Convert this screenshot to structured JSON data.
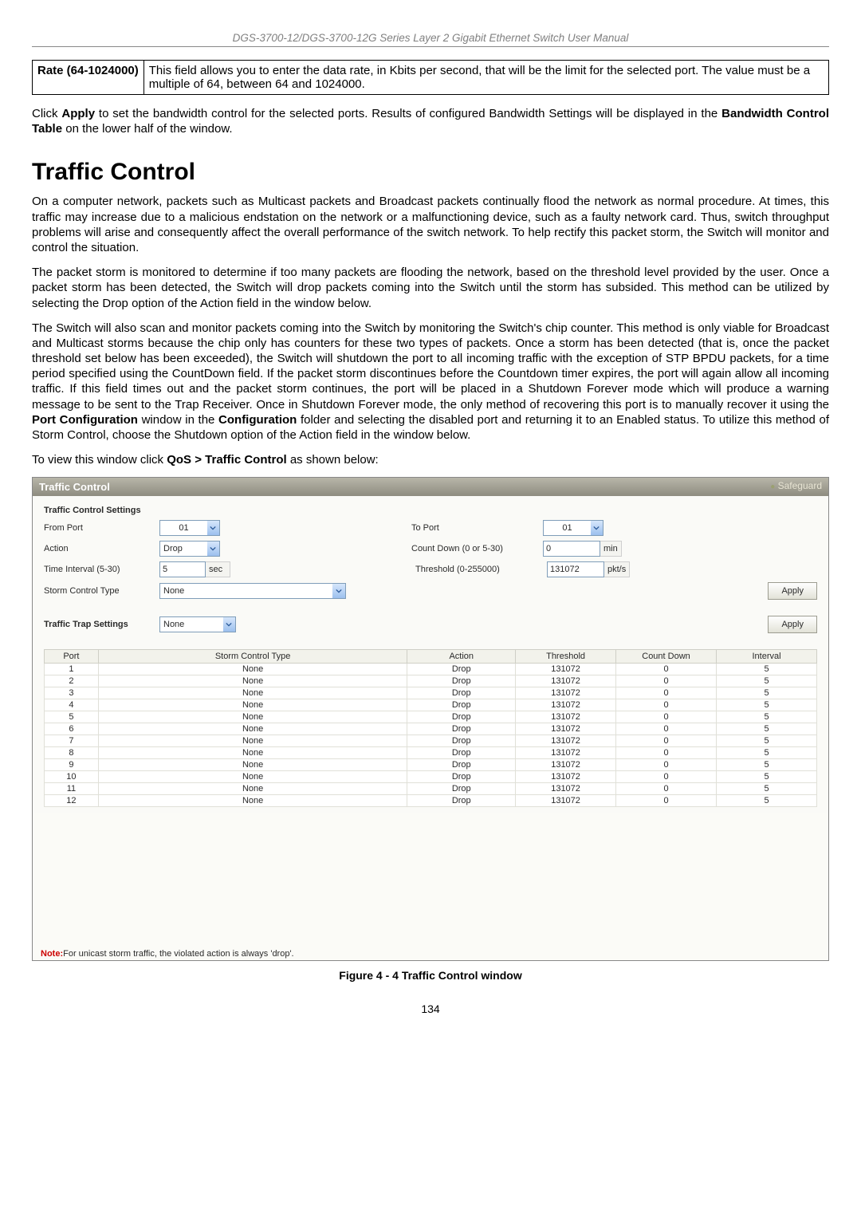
{
  "doc_header": "DGS-3700-12/DGS-3700-12G Series Layer 2 Gigabit Ethernet Switch User Manual",
  "rate_row": {
    "label": "Rate (64-1024000)",
    "desc": "This field allows you to enter the data rate, in Kbits per second, that will be the limit for the selected port. The value must be a multiple of 64, between 64 and 1024000."
  },
  "apply_para": {
    "pre": "Click ",
    "b1": "Apply",
    "mid": " to set the bandwidth control for the selected ports. Results of configured Bandwidth Settings will be displayed in the ",
    "b2": "Bandwidth Control Table",
    "post": " on the lower half of the window."
  },
  "section_title": "Traffic Control",
  "p1": "On a computer network, packets such as Multicast packets and Broadcast packets continually flood the network as normal procedure. At times, this traffic may increase due to a malicious endstation on the network or a malfunctioning device, such as a faulty network card. Thus, switch throughput problems will arise and consequently affect the overall performance of the switch network. To help rectify this packet storm, the Switch will monitor and control the situation.",
  "p2": "The packet storm is monitored to determine if too many packets are flooding the network, based on the threshold level provided by the user. Once a packet storm has been detected, the Switch will drop packets coming into the Switch until the storm has subsided. This method can be utilized by selecting the Drop option of the Action field in the window below.",
  "p3": {
    "a": "The Switch will also scan and monitor packets coming into the Switch by monitoring the Switch's chip counter. This method is only viable for Broadcast and Multicast storms because the chip only has counters for these two types of packets. Once a storm has been detected (that is, once the packet threshold set below has been exceeded), the Switch will shutdown the port to all incoming traffic with the exception of STP BPDU packets, for a time period specified using the CountDown field. If the packet storm discontinues before the Countdown timer expires, the port will again allow all incoming traffic. If this field times out and the packet storm continues, the port will be placed in a Shutdown Forever mode which will produce a warning message to be sent to the Trap Receiver. Once in Shutdown Forever mode, the only method of recovering this port is to manually recover it using the ",
    "b1": "Port Configuration",
    "b": " window in the ",
    "b2": "Configuration",
    "c": " folder and selecting the disabled port and returning it to an Enabled status. To utilize this method of Storm Control, choose the Shutdown option of the Action field in the window below."
  },
  "p4": {
    "pre": "To view this window click ",
    "b": "QoS > Traffic Control",
    "post": " as shown below:"
  },
  "win": {
    "title": "Traffic Control",
    "safeguard": "Safeguard",
    "settings_head": "Traffic Control Settings",
    "from_port_lab": "From Port",
    "from_port_val": "01",
    "to_port_lab": "To Port",
    "to_port_val": "01",
    "action_lab": "Action",
    "action_val": "Drop",
    "countdown_lab": "Count Down (0 or 5-30)",
    "countdown_val": "0",
    "countdown_unit": "min",
    "interval_lab": "Time Interval (5-30)",
    "interval_val": "5",
    "interval_unit": "sec",
    "threshold_lab": "Threshold (0-255000)",
    "threshold_val": "131072",
    "threshold_unit": "pkt/s",
    "storm_lab": "Storm Control Type",
    "storm_val": "None",
    "apply_btn": "Apply",
    "trap_head": "Traffic Trap Settings",
    "trap_val": "None",
    "cols": {
      "c0": "Port",
      "c1": "Storm Control Type",
      "c2": "Action",
      "c3": "Threshold",
      "c4": "Count Down",
      "c5": "Interval"
    },
    "rows": [
      {
        "port": "1",
        "type": "None",
        "action": "Drop",
        "th": "131072",
        "cd": "0",
        "iv": "5"
      },
      {
        "port": "2",
        "type": "None",
        "action": "Drop",
        "th": "131072",
        "cd": "0",
        "iv": "5"
      },
      {
        "port": "3",
        "type": "None",
        "action": "Drop",
        "th": "131072",
        "cd": "0",
        "iv": "5"
      },
      {
        "port": "4",
        "type": "None",
        "action": "Drop",
        "th": "131072",
        "cd": "0",
        "iv": "5"
      },
      {
        "port": "5",
        "type": "None",
        "action": "Drop",
        "th": "131072",
        "cd": "0",
        "iv": "5"
      },
      {
        "port": "6",
        "type": "None",
        "action": "Drop",
        "th": "131072",
        "cd": "0",
        "iv": "5"
      },
      {
        "port": "7",
        "type": "None",
        "action": "Drop",
        "th": "131072",
        "cd": "0",
        "iv": "5"
      },
      {
        "port": "8",
        "type": "None",
        "action": "Drop",
        "th": "131072",
        "cd": "0",
        "iv": "5"
      },
      {
        "port": "9",
        "type": "None",
        "action": "Drop",
        "th": "131072",
        "cd": "0",
        "iv": "5"
      },
      {
        "port": "10",
        "type": "None",
        "action": "Drop",
        "th": "131072",
        "cd": "0",
        "iv": "5"
      },
      {
        "port": "11",
        "type": "None",
        "action": "Drop",
        "th": "131072",
        "cd": "0",
        "iv": "5"
      },
      {
        "port": "12",
        "type": "None",
        "action": "Drop",
        "th": "131072",
        "cd": "0",
        "iv": "5"
      }
    ],
    "note_b": "Note:",
    "note_t": "For unicast storm traffic, the violated action is always 'drop'."
  },
  "figcap": "Figure 4 - 4 Traffic Control window",
  "page_number": "134"
}
